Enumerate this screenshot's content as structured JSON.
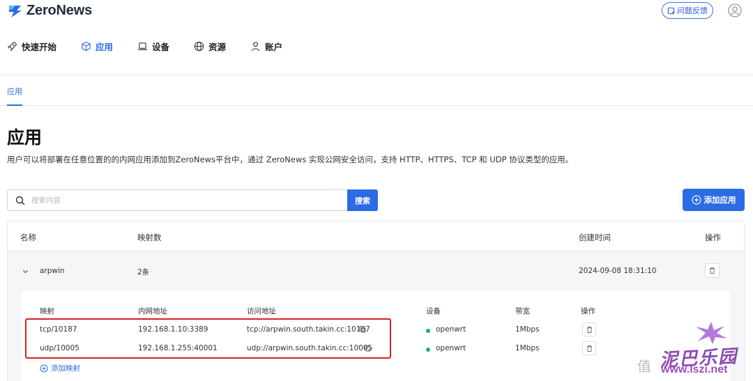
{
  "header": {
    "logo_text": "ZeroNews",
    "feedback_label": "问题反馈",
    "nav": [
      {
        "label": "快速开始",
        "icon": "rocket-icon"
      },
      {
        "label": "应用",
        "icon": "cube-icon",
        "active": true
      },
      {
        "label": "设备",
        "icon": "laptop-icon"
      },
      {
        "label": "资源",
        "icon": "globe-icon"
      },
      {
        "label": "账户",
        "icon": "user-icon"
      }
    ]
  },
  "tabs": [
    {
      "label": "应用"
    }
  ],
  "page": {
    "title": "应用",
    "description": "用户可以将部署在任意位置的的内网应用添加到ZeroNews平台中，通过 ZeroNews 实现公网安全访问，支持 HTTP、HTTPS、TCP 和 UDP 协议类型的应用。"
  },
  "search": {
    "placeholder": "搜索内容",
    "button_label": "搜索"
  },
  "add_app_label": "添加应用",
  "table": {
    "columns": [
      "名称",
      "映射数",
      "创建时间",
      "操作"
    ],
    "rows": [
      {
        "name": "arpwin",
        "mapping_count": "2条",
        "created": "2024-09-08 18:31:10",
        "expanded": true,
        "sub_columns": [
          "映射",
          "内网地址",
          "访问地址",
          "设备",
          "带宽",
          "操作"
        ],
        "mappings": [
          {
            "mapping": "tcp/10187",
            "internal": "192.168.1.10:3389",
            "access": "tcp://arpwin.south.takin.cc:10187",
            "device": "openwrt",
            "bandwidth": "1Mbps"
          },
          {
            "mapping": "udp/10005",
            "internal": "192.168.1.255:40001",
            "access": "udp://arpwin.south.takin.cc:10005",
            "device": "openwrt",
            "bandwidth": "1Mbps"
          }
        ],
        "add_mapping_label": "添加映射"
      }
    ]
  },
  "watermark": {
    "zhi": "值",
    "site_text": "泥巴乐园",
    "url": "www.lszi.net"
  },
  "colors": {
    "accent": "#2b6be6",
    "online": "#20b25a",
    "highlight": "#d62020",
    "watermark": "#7a2ca8"
  }
}
